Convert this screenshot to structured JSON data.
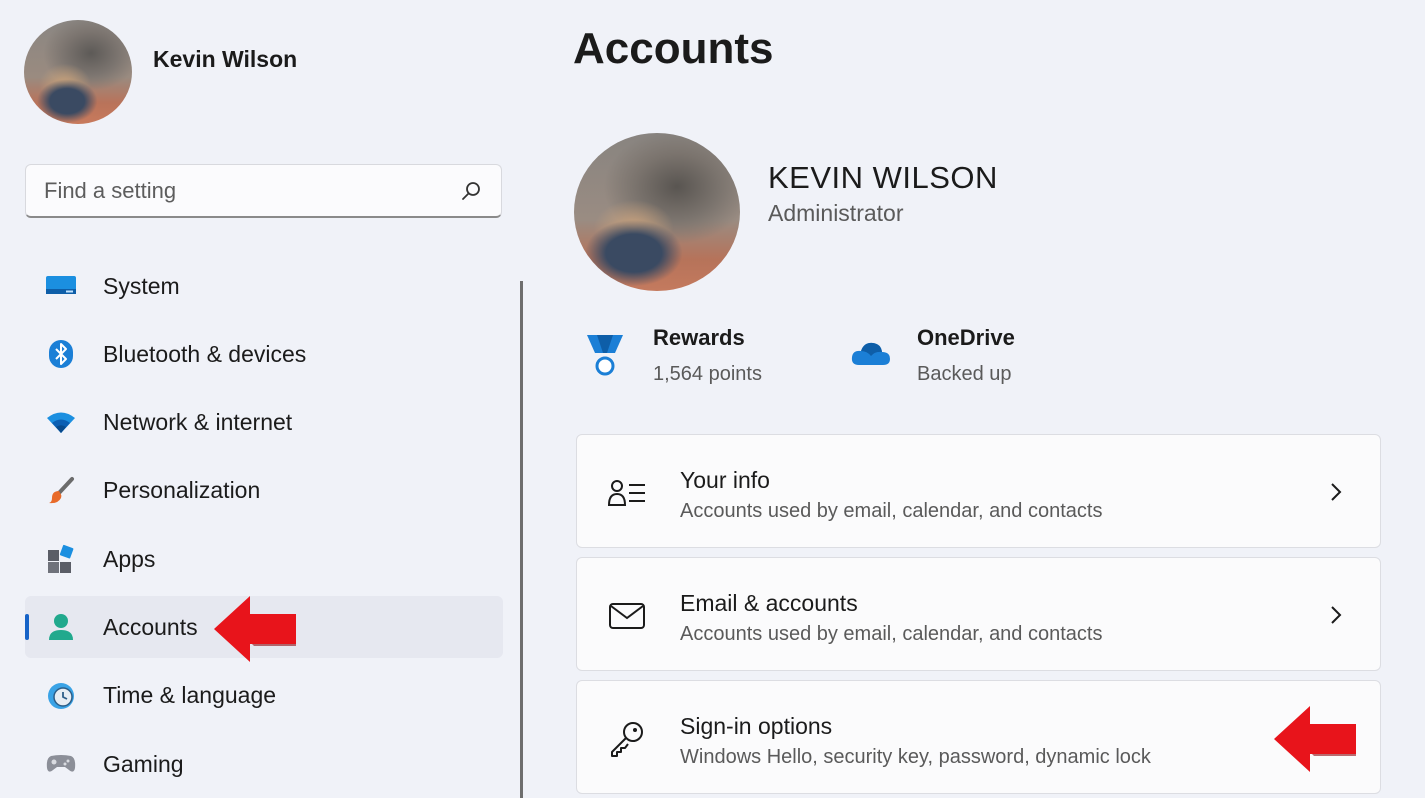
{
  "user": {
    "name": "Kevin Wilson"
  },
  "search": {
    "placeholder": "Find a setting"
  },
  "sidebar": {
    "items": [
      {
        "label": "System",
        "icon": "system-icon"
      },
      {
        "label": "Bluetooth & devices",
        "icon": "bluetooth-icon"
      },
      {
        "label": "Network & internet",
        "icon": "wifi-icon"
      },
      {
        "label": "Personalization",
        "icon": "brush-icon"
      },
      {
        "label": "Apps",
        "icon": "apps-icon"
      },
      {
        "label": "Accounts",
        "icon": "accounts-icon",
        "active": true
      },
      {
        "label": "Time & language",
        "icon": "clock-globe-icon"
      },
      {
        "label": "Gaming",
        "icon": "gamepad-icon"
      }
    ]
  },
  "main": {
    "title": "Accounts",
    "profile": {
      "name": "KEVIN WILSON",
      "role": "Administrator"
    },
    "stats": [
      {
        "title": "Rewards",
        "sub": "1,564 points",
        "icon": "medal-icon"
      },
      {
        "title": "OneDrive",
        "sub": "Backed up",
        "icon": "cloud-icon"
      }
    ],
    "cards": [
      {
        "title": "Your info",
        "sub": "Accounts used by email, calendar, and contacts",
        "icon": "person-list-icon"
      },
      {
        "title": "Email & accounts",
        "sub": "Accounts used by email, calendar, and contacts",
        "icon": "mail-icon"
      },
      {
        "title": "Sign-in options",
        "sub": "Windows Hello, security key, password, dynamic lock",
        "icon": "key-icon"
      }
    ]
  },
  "colors": {
    "background": "#f0f2f8",
    "accent": "#1663c7",
    "annotation_arrow": "#e8141b"
  }
}
